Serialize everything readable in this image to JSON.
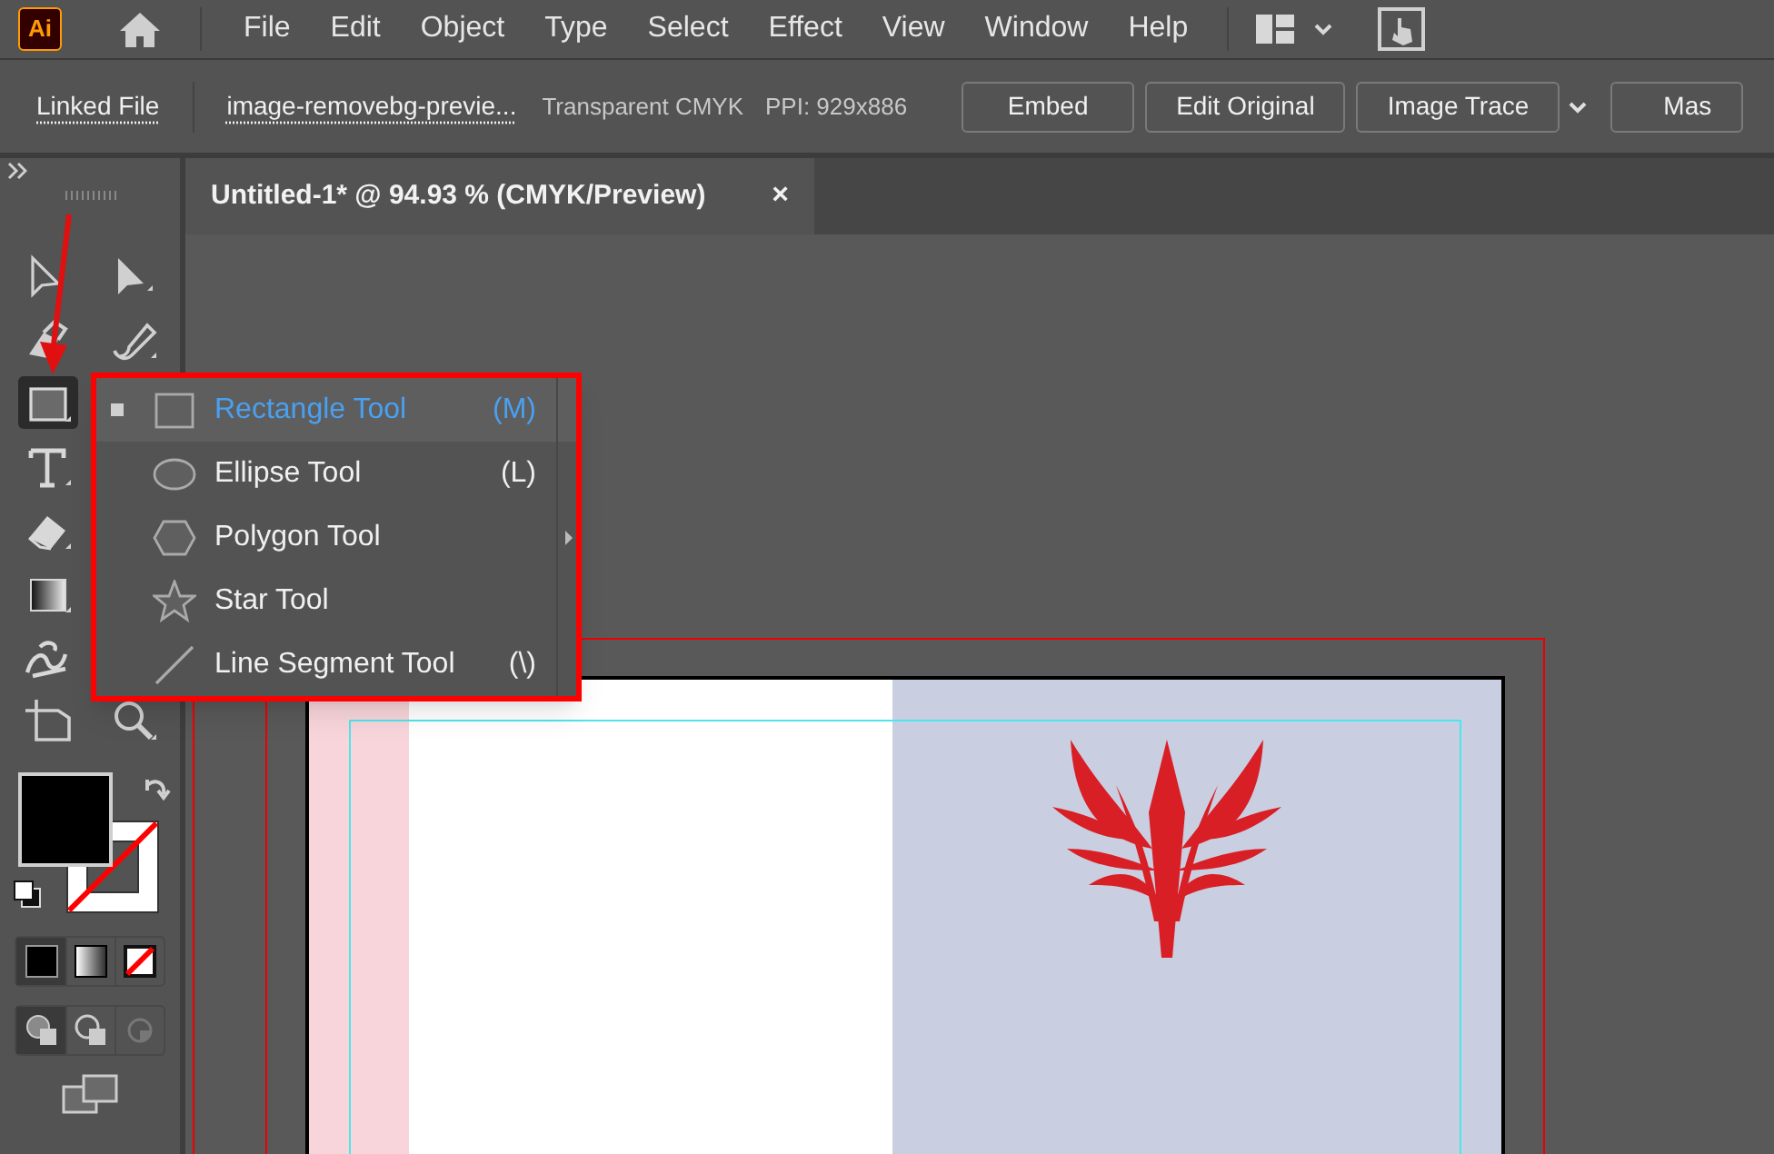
{
  "app_logo": "Ai",
  "menu": [
    "File",
    "Edit",
    "Object",
    "Type",
    "Select",
    "Effect",
    "View",
    "Window",
    "Help"
  ],
  "control_bar": {
    "linked_file": "Linked File",
    "file_name": "image-removebg-previe...",
    "color_mode": "Transparent CMYK",
    "ppi": "PPI: 929x886",
    "buttons": [
      {
        "label": "Embed",
        "dropdown": false
      },
      {
        "label": "Edit Original",
        "dropdown": false
      },
      {
        "label": "Image Trace",
        "dropdown": true
      },
      {
        "label": "Mas",
        "dropdown": false
      }
    ]
  },
  "document_tab": {
    "title": "Untitled-1* @ 94.93 % (CMYK/Preview)",
    "close": "×"
  },
  "tools": [
    {
      "kind": "select",
      "selected": false
    },
    {
      "kind": "direct",
      "selected": false
    },
    {
      "kind": "blob",
      "selected": false
    },
    {
      "kind": "pen",
      "selected": false
    },
    {
      "kind": "rect",
      "selected": true
    },
    {
      "kind": "type",
      "selected": false
    },
    {
      "kind": "eraser",
      "selected": false
    },
    {
      "kind": "gradient",
      "selected": false
    },
    {
      "kind": "puppet",
      "selected": false
    },
    {
      "kind": "artboard",
      "selected": false
    },
    {
      "kind": "zoom",
      "selected": false
    }
  ],
  "flyout": [
    {
      "kind": "rect",
      "label": "Rectangle Tool",
      "shortcut": "(M)",
      "selected": true
    },
    {
      "kind": "ellipse",
      "label": "Ellipse Tool",
      "shortcut": "(L)",
      "selected": false
    },
    {
      "kind": "polygon",
      "label": "Polygon Tool",
      "selected": false
    },
    {
      "kind": "star",
      "label": "Star Tool",
      "selected": false
    },
    {
      "kind": "line",
      "label": "Line Segment Tool",
      "shortcut": "(\\)",
      "selected": false
    }
  ]
}
